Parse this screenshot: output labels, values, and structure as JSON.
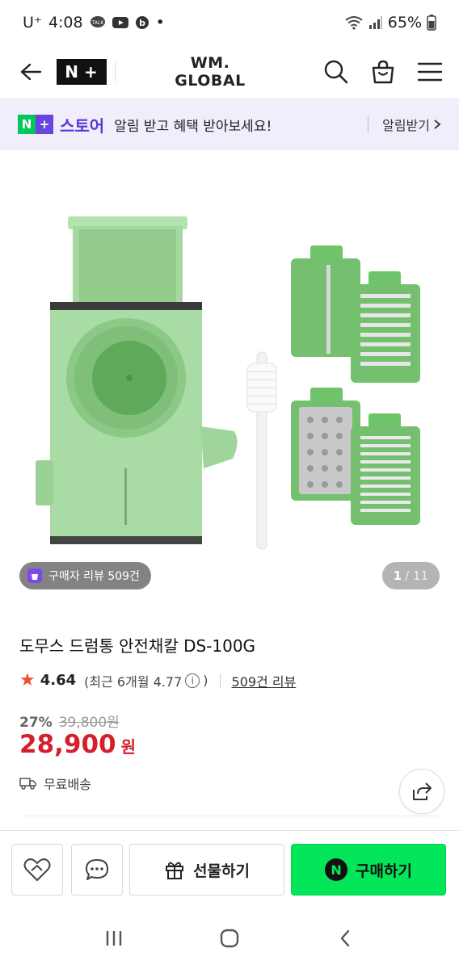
{
  "status_bar": {
    "carrier": "U⁺",
    "time": "4:08",
    "dot": "•",
    "battery": "65%"
  },
  "header": {
    "logo_text_n": "N",
    "logo_text_plus": "+",
    "brand": "WM. GLOBAL"
  },
  "banner": {
    "store_name": "스토어",
    "message": "알림 받고 혜택 받아보세요!",
    "link_label": "알림받기"
  },
  "image": {
    "review_badge": "구매자 리뷰 509건",
    "page_current": "1",
    "page_total": "/ 11"
  },
  "product": {
    "title": "도무스 드럼통 안전채칼 DS-100G",
    "rating": "4.64",
    "recent_rating": "(최근 6개월 4.77",
    "recent_close": ")",
    "info_icon_glyph": "i",
    "review_count": "509건 리뷰",
    "discount_rate": "27%",
    "original_price": "39,800원",
    "sale_price": "28,900",
    "sale_unit": "원",
    "shipping": "무료배송"
  },
  "bottom_bar": {
    "gift_label": "선물하기",
    "buy_label": "구매하기",
    "npay_glyph": "N"
  },
  "colors": {
    "accent_purple": "#5b35d5",
    "naver_green": "#03c75a",
    "buy_green": "#03e65a",
    "price_red": "#d4202c",
    "product_green": "#a6d9a0"
  }
}
